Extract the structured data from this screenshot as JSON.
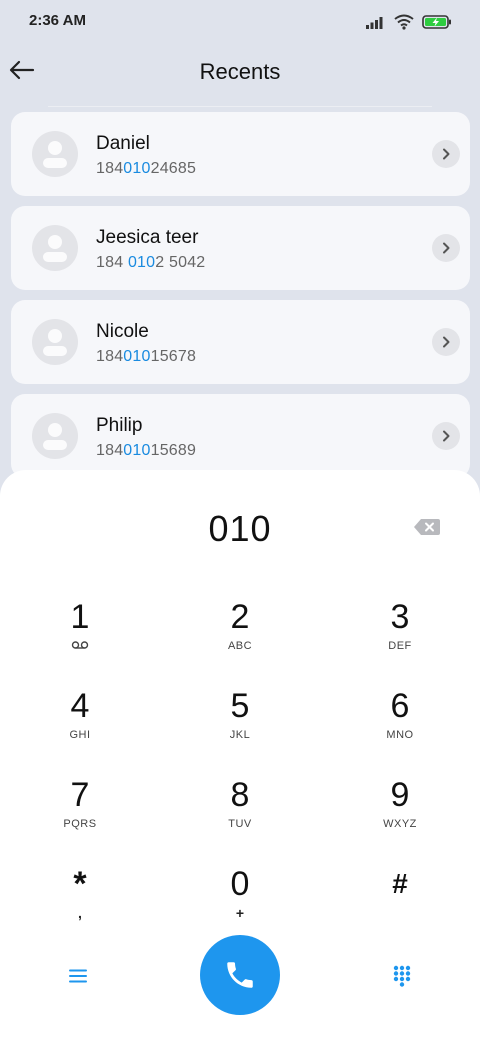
{
  "status_bar": {
    "time": "2:36 AM",
    "icons": [
      "signal-icon",
      "wifi-icon",
      "battery-charging-icon"
    ],
    "battery_color": "#2ecc40"
  },
  "header": {
    "title": "Recents",
    "back_icon": "arrow-left-icon"
  },
  "contacts": [
    {
      "name": "Daniel",
      "number_parts": [
        "184",
        "010",
        "24685"
      ]
    },
    {
      "name": "Jeesica teer",
      "number_parts": [
        "184 ",
        "010",
        "2 5042"
      ]
    },
    {
      "name": "Nicole",
      "number_parts": [
        "184",
        "010",
        "15678"
      ]
    },
    {
      "name": "Philip",
      "number_parts": [
        "184",
        "010",
        "15689"
      ]
    }
  ],
  "dialer": {
    "input_value": "010",
    "keys": [
      {
        "digit": "1",
        "letters": ""
      },
      {
        "digit": "2",
        "letters": "ABC"
      },
      {
        "digit": "3",
        "letters": "DEF"
      },
      {
        "digit": "4",
        "letters": "GHI"
      },
      {
        "digit": "5",
        "letters": "JKL"
      },
      {
        "digit": "6",
        "letters": "MNO"
      },
      {
        "digit": "7",
        "letters": "PQRS"
      },
      {
        "digit": "8",
        "letters": "TUV"
      },
      {
        "digit": "9",
        "letters": "WXYZ"
      },
      {
        "digit": "*",
        "sub": ","
      },
      {
        "digit": "0",
        "sub": "+"
      },
      {
        "digit": "#",
        "sub": ""
      }
    ]
  },
  "bottom_bar": {
    "menu_icon": "menu-icon",
    "call_icon": "phone-icon",
    "keypad_icon": "keypad-grid-icon",
    "accent_color": "#1e96ee"
  },
  "colors": {
    "highlight": "#1a8be0",
    "background": "#dfe3ec",
    "card": "#f6f7fa"
  }
}
